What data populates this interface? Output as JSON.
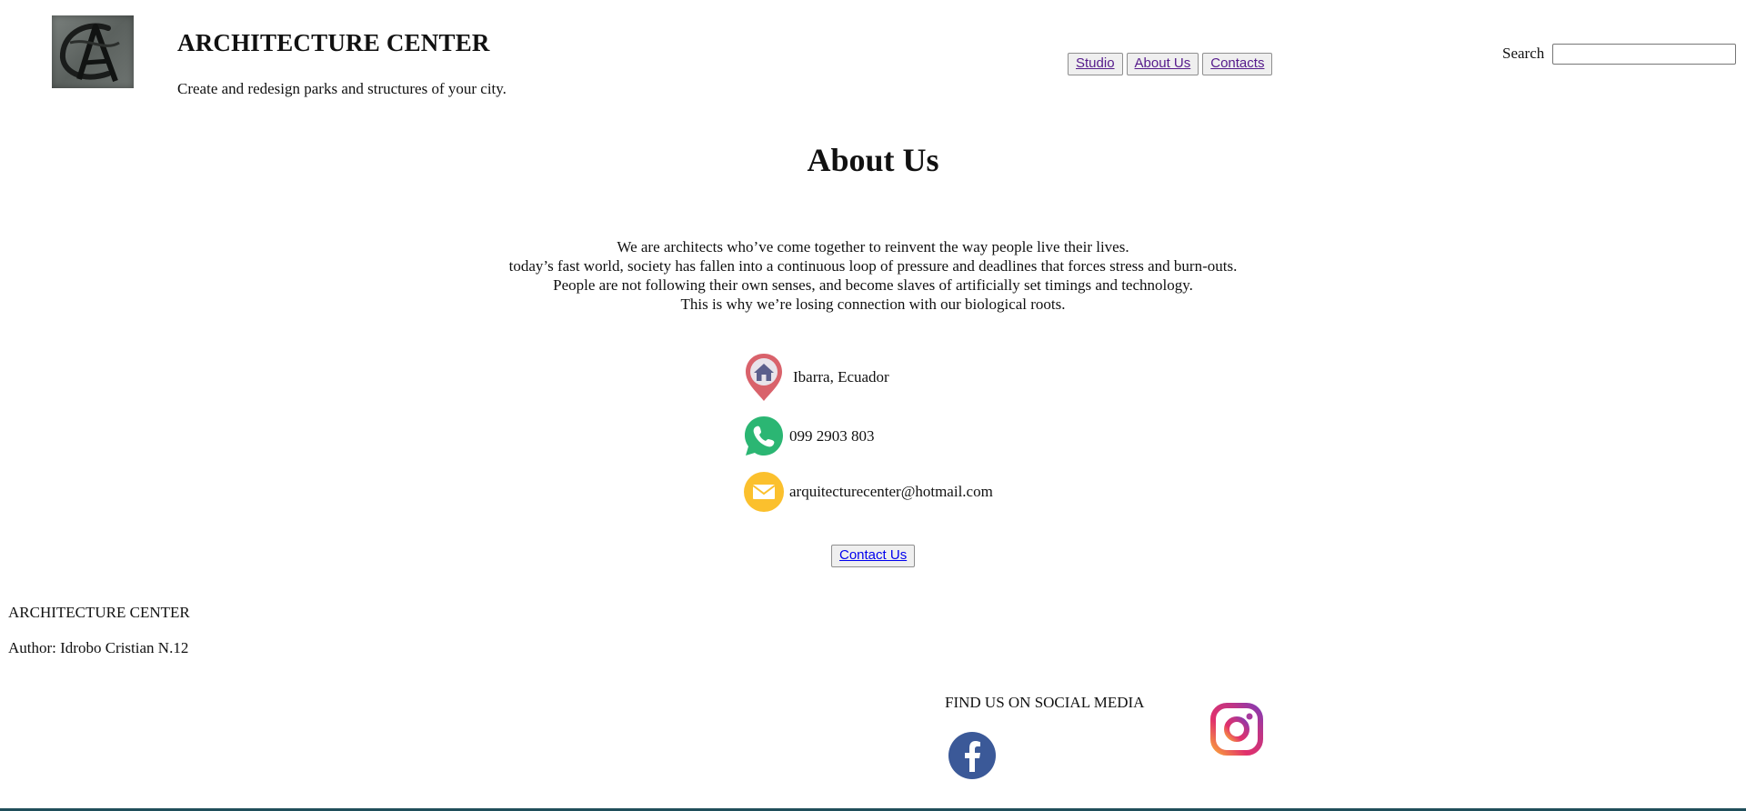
{
  "header": {
    "logo_icon": "architecture-center-logo",
    "title": "ARCHITECTURE CENTER",
    "tagline": "Create and redesign parks and structures of your city.",
    "nav": [
      {
        "label": "Studio"
      },
      {
        "label": "About Us"
      },
      {
        "label": "Contacts"
      }
    ],
    "search": {
      "label": "Search",
      "value": "",
      "placeholder": ""
    }
  },
  "main": {
    "heading": "About Us",
    "intro_lines": [
      "We are architects who’ve come together to reinvent the way people live their lives.",
      "today’s fast world, society has fallen into a continuous loop of pressure and deadlines that forces stress and burn-outs.",
      "People are not following their own senses, and become slaves of artificially set timings and technology.",
      "This is why we’re losing connection with our biological roots."
    ],
    "contacts": [
      {
        "icon": "location-pin-icon",
        "text": "Ibarra, Ecuador"
      },
      {
        "icon": "whatsapp-phone-icon",
        "text": "099 2903 803"
      },
      {
        "icon": "email-icon",
        "text": "arquitecturecenter@hotmail.com"
      }
    ],
    "contact_button": "Contact Us"
  },
  "footer": {
    "name": "ARCHITECTURE CENTER",
    "author": "Author: Idrobo Cristian N.12",
    "social_title": "FIND US ON SOCIAL MEDIA",
    "social": [
      {
        "icon": "facebook-icon"
      },
      {
        "icon": "instagram-icon"
      }
    ]
  },
  "colors": {
    "visited_link": "#551a8b",
    "link": "#0000ee",
    "pin": "#d9626b",
    "whatsapp": "#2bb673",
    "email": "#fbc02d",
    "facebook": "#3b5998",
    "bottom_bar": "#1f4e5a"
  }
}
